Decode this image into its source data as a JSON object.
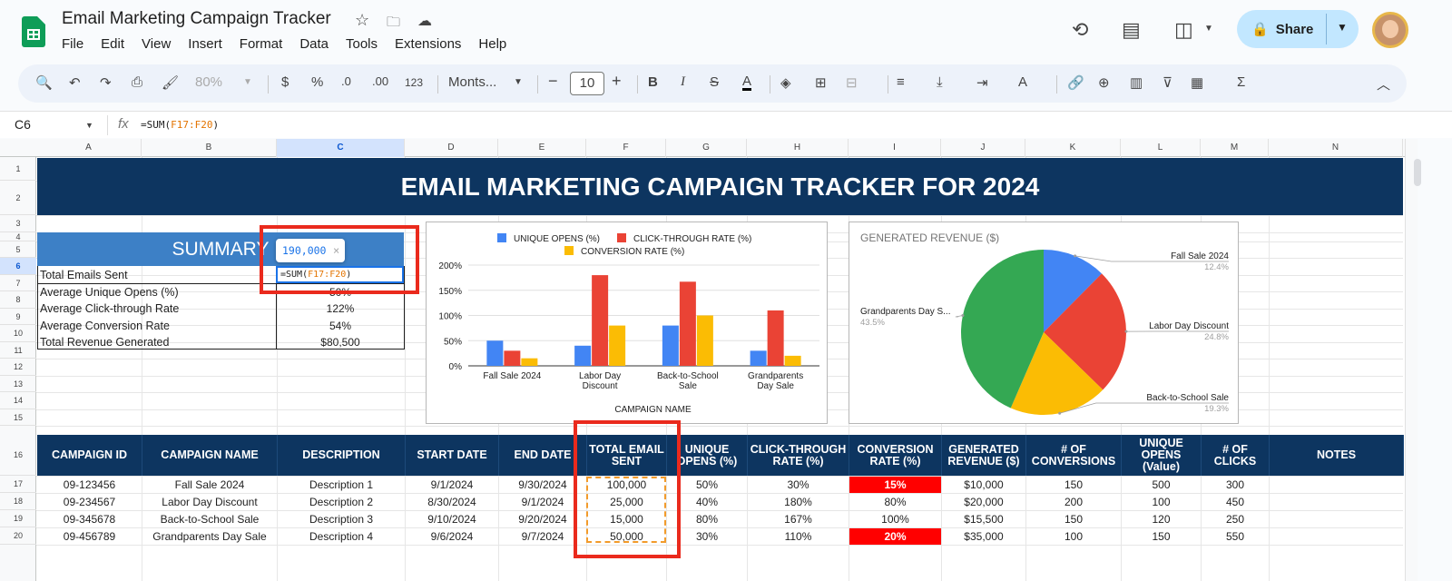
{
  "app": {
    "doc_title": "Email Marketing Campaign Tracker",
    "menus": [
      "File",
      "Edit",
      "View",
      "Insert",
      "Format",
      "Data",
      "Tools",
      "Extensions",
      "Help"
    ],
    "share_label": "Share"
  },
  "toolbar": {
    "zoom": "80%",
    "currency": "$",
    "percent": "%",
    "dec_less": ".0",
    "dec_more": ".00",
    "num_format": "123",
    "font": "Monts...",
    "font_size": "10"
  },
  "formula_bar": {
    "cell_ref": "C6",
    "formula_prefix": "=SUM(",
    "formula_range": "F17:F20",
    "formula_suffix": ")"
  },
  "sheet": {
    "columns": [
      "A",
      "B",
      "C",
      "D",
      "E",
      "F",
      "G",
      "H",
      "I",
      "J",
      "K",
      "L",
      "M",
      "N"
    ],
    "rows": [
      "1",
      "2",
      "3",
      "4",
      "5",
      "6",
      "7",
      "8",
      "9",
      "10",
      "11",
      "12",
      "13",
      "14",
      "15",
      "16",
      "17",
      "18",
      "19",
      "20"
    ],
    "banner": "EMAIL MARKETING CAMPAIGN TRACKER FOR 2024",
    "summary": {
      "title": "SUMMARY",
      "tooltip": "190,000",
      "items": [
        {
          "label": "Total Emails Sent",
          "value": "=SUM(F17:F20)"
        },
        {
          "label": "Average Unique Opens (%)",
          "value": "50%"
        },
        {
          "label": "Average Click-through Rate",
          "value": "122%"
        },
        {
          "label": "Average Conversion Rate",
          "value": "54%"
        },
        {
          "label": "Total Revenue Generated",
          "value": "$80,500"
        }
      ]
    },
    "table": {
      "headers": [
        "CAMPAIGN ID",
        "CAMPAIGN NAME",
        "DESCRIPTION",
        "START DATE",
        "END DATE",
        "TOTAL EMAIL SENT",
        "UNIQUE OPENS (%)",
        "CLICK-THROUGH RATE (%)",
        "CONVERSION RATE (%)",
        "GENERATED REVENUE ($)",
        "# OF CONVERSIONS",
        "UNIQUE OPENS (Value)",
        "# OF CLICKS",
        "NOTES"
      ],
      "rows": [
        [
          "09-123456",
          "Fall Sale 2024",
          "Description 1",
          "9/1/2024",
          "9/30/2024",
          "100,000",
          "50%",
          "30%",
          "15%",
          "$10,000",
          "150",
          "500",
          "300",
          ""
        ],
        [
          "09-234567",
          "Labor Day Discount",
          "Description 2",
          "8/30/2024",
          "9/1/2024",
          "25,000",
          "40%",
          "180%",
          "80%",
          "$20,000",
          "200",
          "100",
          "450",
          ""
        ],
        [
          "09-345678",
          "Back-to-School Sale",
          "Description 3",
          "9/10/2024",
          "9/20/2024",
          "15,000",
          "80%",
          "167%",
          "100%",
          "$15,500",
          "150",
          "120",
          "250",
          ""
        ],
        [
          "09-456789",
          "Grandparents Day Sale",
          "Description 4",
          "9/6/2024",
          "9/7/2024",
          "50,000",
          "30%",
          "110%",
          "20%",
          "$35,000",
          "100",
          "150",
          "550",
          ""
        ]
      ]
    }
  },
  "chart_data": [
    {
      "type": "bar",
      "title": "",
      "xlabel": "CAMPAIGN NAME",
      "ylabel": "",
      "categories": [
        "Fall Sale 2024",
        "Labor Day Discount",
        "Back-to-School Sale",
        "Grandparents Day Sale"
      ],
      "series": [
        {
          "name": "UNIQUE OPENS (%)",
          "color": "#4285f4",
          "values": [
            50,
            40,
            80,
            30
          ]
        },
        {
          "name": "CLICK-THROUGH RATE (%)",
          "color": "#ea4335",
          "values": [
            30,
            180,
            167,
            110
          ]
        },
        {
          "name": "CONVERSION RATE (%)",
          "color": "#fbbc04",
          "values": [
            15,
            80,
            100,
            20
          ]
        }
      ],
      "yticks": [
        "0%",
        "50%",
        "100%",
        "150%",
        "200%"
      ],
      "ylim": [
        0,
        200
      ],
      "grid": true,
      "legend": "top"
    },
    {
      "type": "pie",
      "title": "GENERATED REVENUE ($)",
      "slices": [
        {
          "label": "Fall Sale 2024",
          "pct": "12.4%",
          "value": 10000,
          "color": "#4285f4"
        },
        {
          "label": "Labor Day Discount",
          "pct": "24.8%",
          "value": 20000,
          "color": "#ea4335"
        },
        {
          "label": "Back-to-School Sale",
          "pct": "19.3%",
          "value": 15500,
          "color": "#fbbc04"
        },
        {
          "label": "Grandparents Day S...",
          "pct": "43.5%",
          "value": 35000,
          "color": "#34a853"
        }
      ]
    }
  ]
}
